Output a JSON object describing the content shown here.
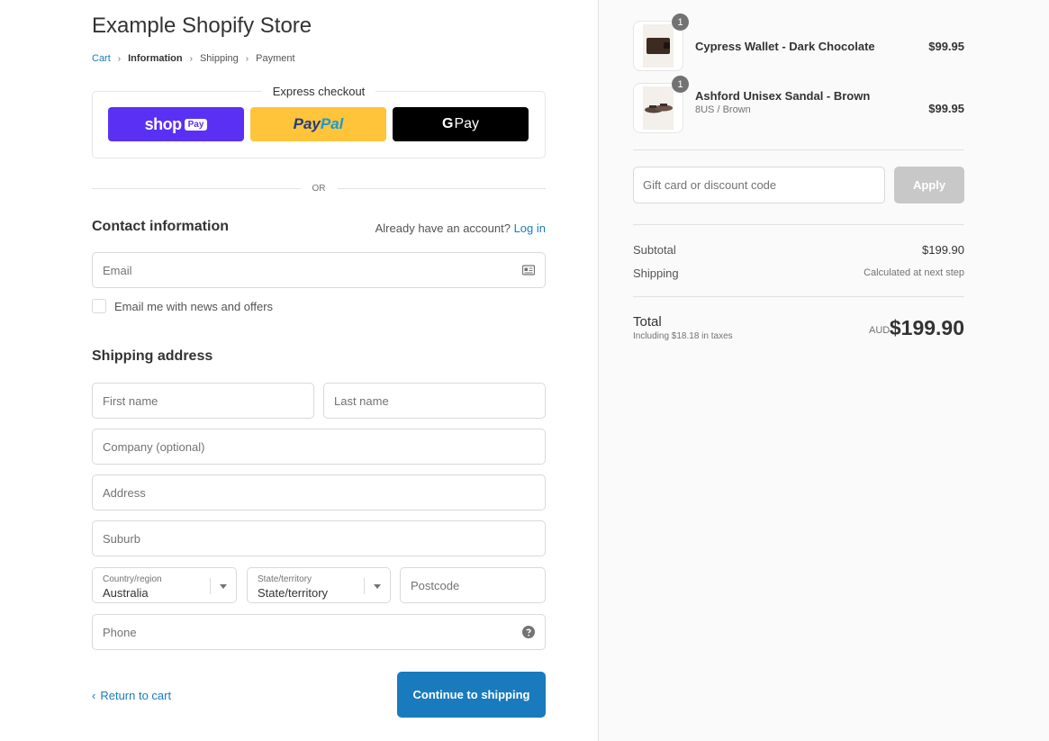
{
  "store": {
    "title": "Example Shopify Store"
  },
  "breadcrumb": {
    "cart": "Cart",
    "information": "Information",
    "shipping": "Shipping",
    "payment": "Payment",
    "separator": "›"
  },
  "express": {
    "label": "Express checkout",
    "shop_pay": {
      "brand": "shop",
      "tag": "Pay"
    },
    "paypal": {
      "part1": "Pay",
      "part2": "Pal"
    },
    "gpay": {
      "g": "G",
      "label": "Pay"
    },
    "or": "OR"
  },
  "contact": {
    "heading": "Contact information",
    "account_prompt": "Already have an account?",
    "login_link": "Log in",
    "email_placeholder": "Email",
    "newsletter_label": "Email me with news and offers"
  },
  "shipping": {
    "heading": "Shipping address",
    "first_name": "First name",
    "last_name": "Last name",
    "company": "Company (optional)",
    "address": "Address",
    "suburb": "Suburb",
    "country_label": "Country/region",
    "country_value": "Australia",
    "state_label": "State/territory",
    "state_value": "State/territory",
    "postcode": "Postcode",
    "phone": "Phone"
  },
  "footer": {
    "return_link": "Return to cart",
    "return_chevron": "‹",
    "continue_button": "Continue to shipping"
  },
  "order": {
    "items": [
      {
        "quantity": "1",
        "name": "Cypress Wallet - Dark Chocolate",
        "variant": "",
        "price": "$99.95"
      },
      {
        "quantity": "1",
        "name": "Ashford Unisex Sandal - Brown",
        "variant": "8US / Brown",
        "price": "$99.95"
      }
    ],
    "discount_placeholder": "Gift card or discount code",
    "apply_button": "Apply",
    "subtotal_label": "Subtotal",
    "subtotal_value": "$199.90",
    "shipping_label": "Shipping",
    "shipping_value": "Calculated at next step",
    "total_label": "Total",
    "taxes_note": "Including $18.18 in taxes",
    "currency": "AUD",
    "total_value": "$199.90"
  },
  "colors": {
    "accent": "#197bbd",
    "shop_pay": "#5a31f4",
    "paypal": "#ffc439",
    "gpay": "#000000",
    "apply_disabled": "#c8c8c8",
    "sidebar_bg": "#fafafa"
  }
}
